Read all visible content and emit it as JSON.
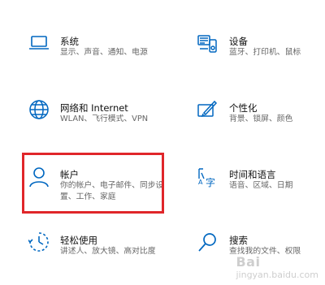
{
  "accent_color": "#0067c0",
  "highlight_color": "#e0262a",
  "items": [
    {
      "title": "系统",
      "desc1": "显示、声音、通知、电源",
      "desc2": "",
      "icon": "laptop-icon"
    },
    {
      "title": "设备",
      "desc1": "蓝牙、打印机、鼠标",
      "desc2": "",
      "icon": "devices-icon"
    },
    {
      "title": "网络和 Internet",
      "desc1": "WLAN、飞行模式、VPN",
      "desc2": "",
      "icon": "globe-icon"
    },
    {
      "title": "个性化",
      "desc1": "背景、锁屏、颜色",
      "desc2": "",
      "icon": "personalization-icon"
    },
    {
      "title": "帐户",
      "desc1": "你的帐户、电子邮件、同步设",
      "desc2": "置、工作、家庭",
      "icon": "person-icon"
    },
    {
      "title": "时间和语言",
      "desc1": "语音、区域、日期",
      "desc2": "",
      "icon": "time-language-icon"
    },
    {
      "title": "轻松使用",
      "desc1": "讲述人、放大镜、高对比度",
      "desc2": "",
      "icon": "ease-of-access-icon"
    },
    {
      "title": "搜索",
      "desc1": "查找我的文件、权限",
      "desc2": "",
      "icon": "search-icon"
    }
  ],
  "watermark": {
    "line1": "Bai",
    "line2": "jingyan.baidu.com"
  }
}
